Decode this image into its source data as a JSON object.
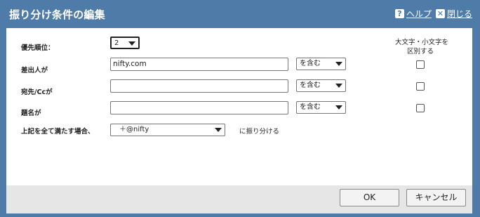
{
  "dialog": {
    "title": "振り分け条件の編集",
    "help_label": "ヘルプ",
    "close_label": "閉じる"
  },
  "case_note": {
    "line1": "大文字・小文字を",
    "line2": "区別する"
  },
  "priority": {
    "label": "優先順位：",
    "value": "2"
  },
  "rows": [
    {
      "label": "差出人が",
      "value": "nifty.com",
      "operator": "を含む",
      "case_sensitive": false
    },
    {
      "label": "宛先/Ccが",
      "value": "",
      "operator": "を含む",
      "case_sensitive": false
    },
    {
      "label": "題名が",
      "value": "",
      "operator": "を含む",
      "case_sensitive": false
    }
  ],
  "destination": {
    "label": "上記を全て満たす場合、",
    "folder": "＋@nifty",
    "suffix": "に振り分ける"
  },
  "buttons": {
    "ok": "OK",
    "cancel": "キャンセル"
  }
}
